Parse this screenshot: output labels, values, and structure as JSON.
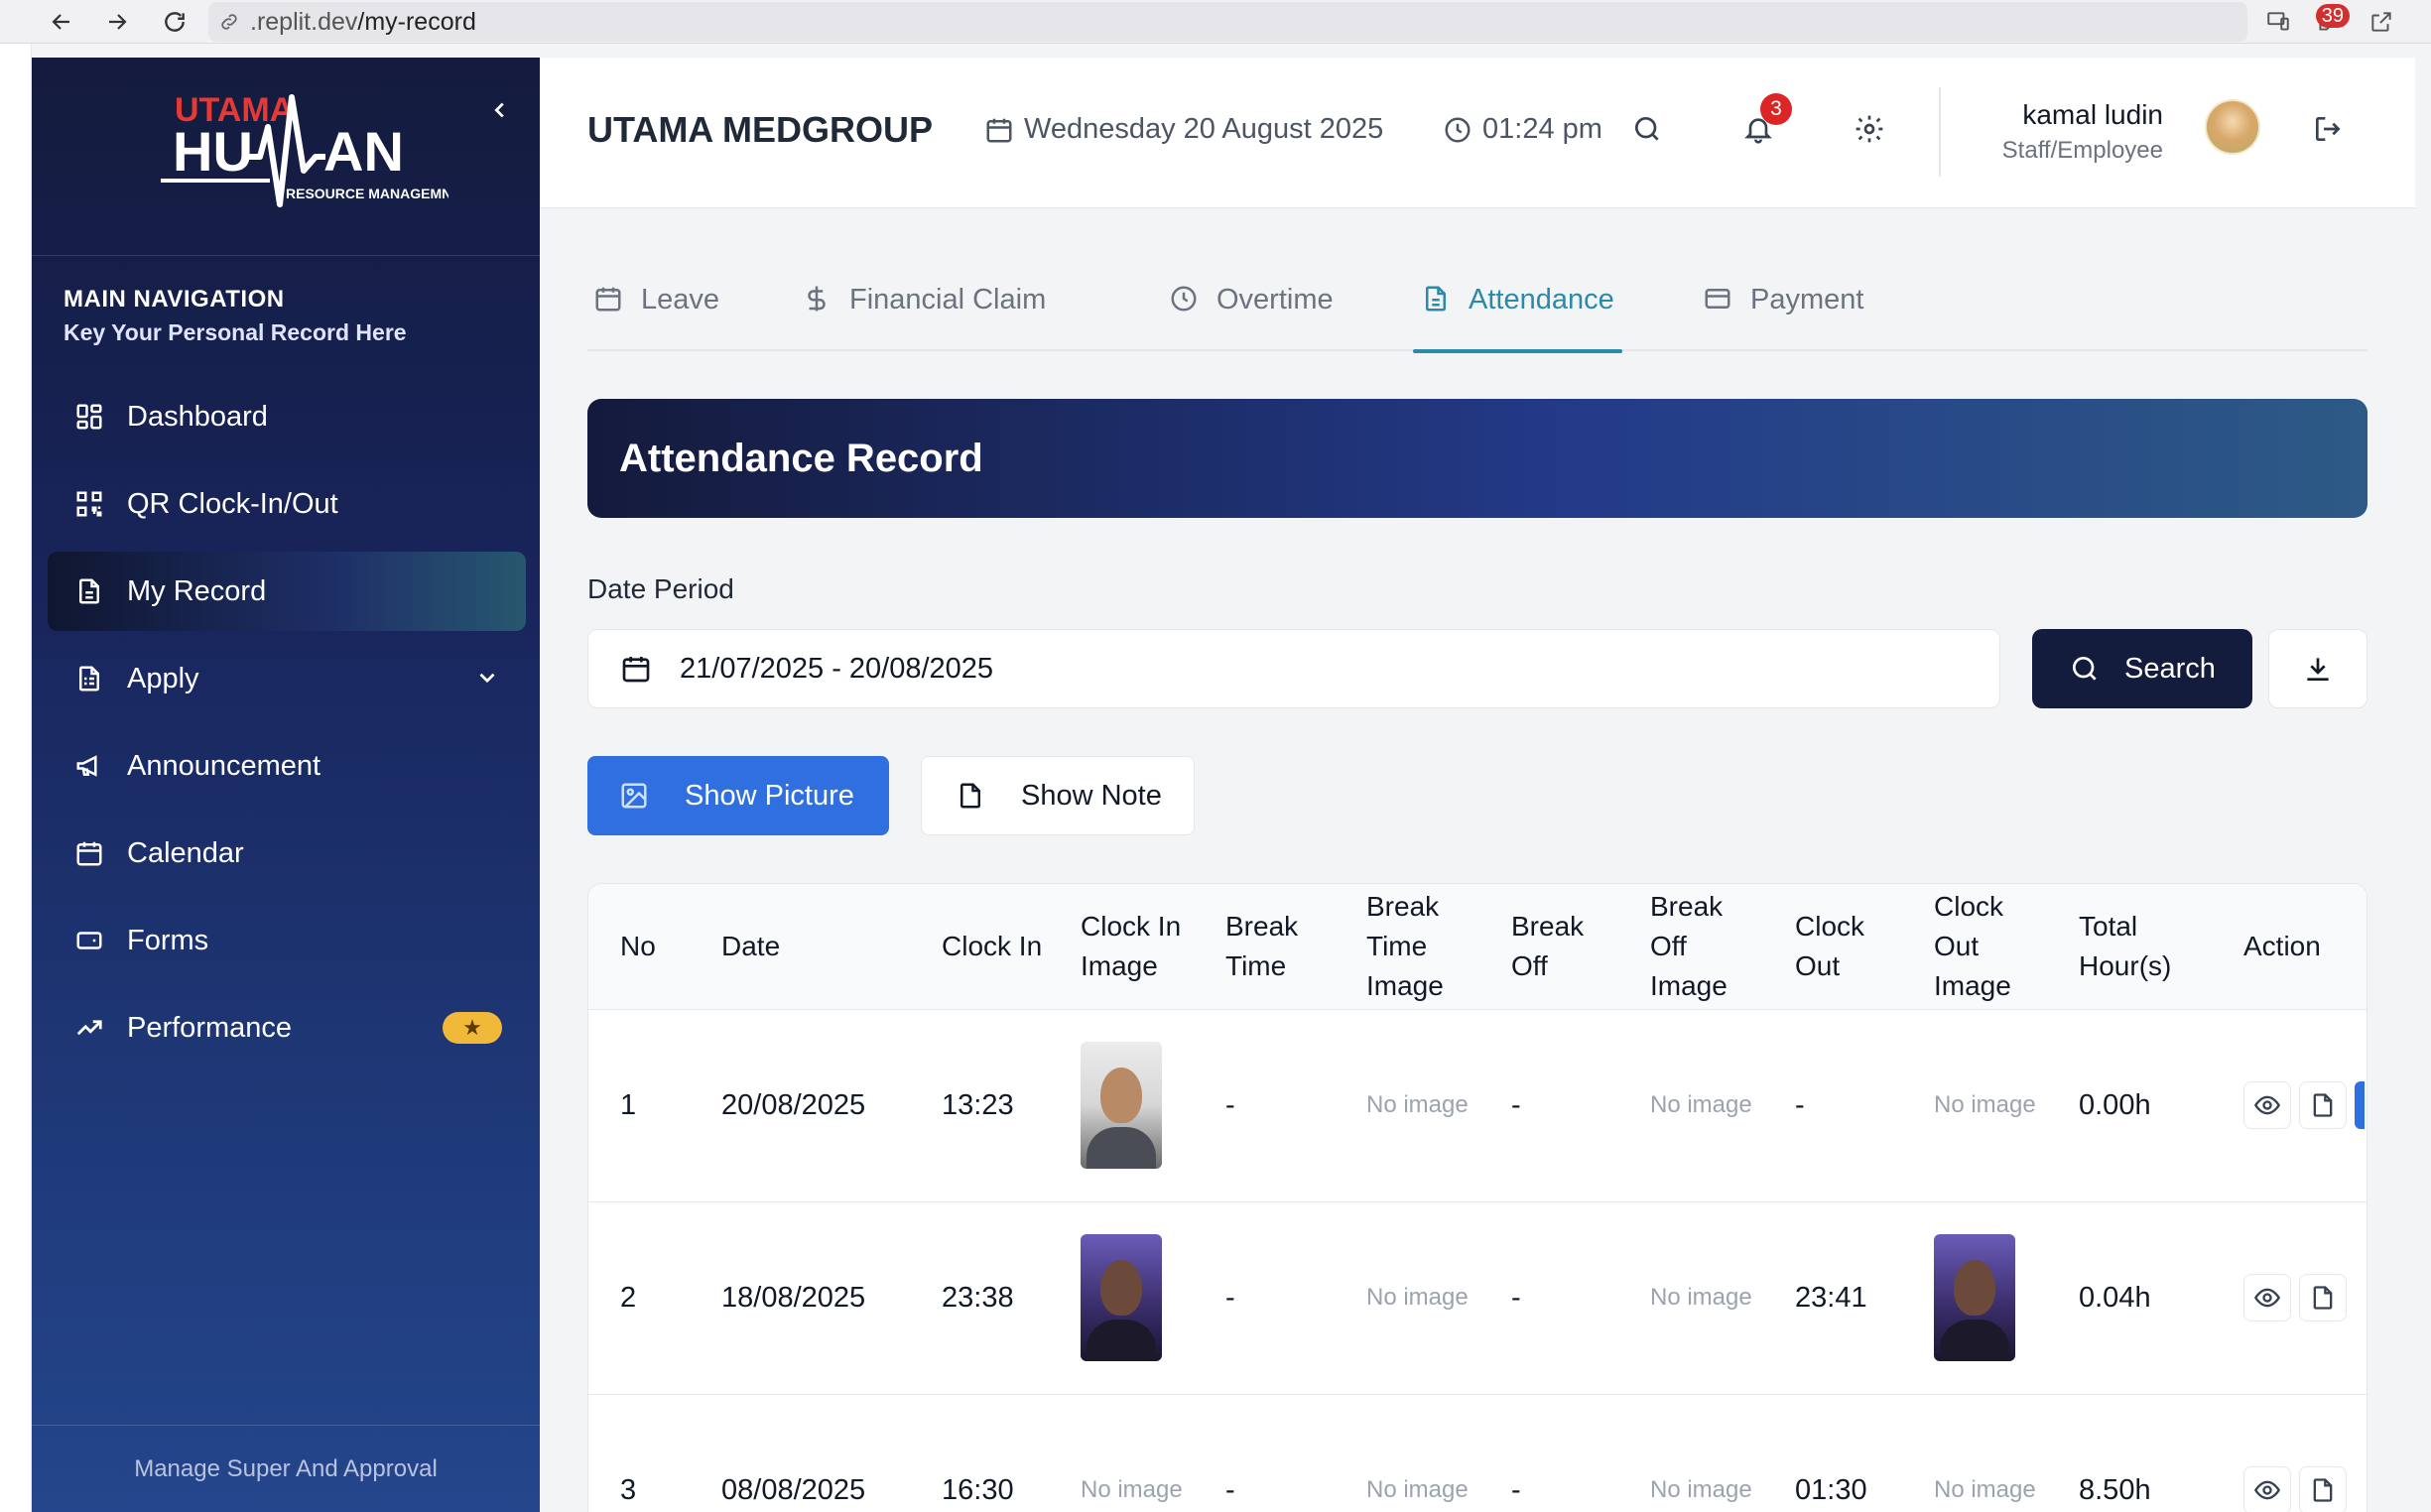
{
  "browser": {
    "url_prefix": ".replit.dev",
    "url_path": "/my-record",
    "ext_badge": "39"
  },
  "sidebar": {
    "logo_top": "UTAMA",
    "logo_main": "HUMAN",
    "logo_sub": "RESOURCE MANAGEMNET",
    "heading": "MAIN NAVIGATION",
    "subheading": "Key Your Personal Record Here",
    "items": [
      {
        "label": "Dashboard",
        "icon": "dashboard-icon"
      },
      {
        "label": "QR Clock-In/Out",
        "icon": "qr-icon"
      },
      {
        "label": "My Record",
        "icon": "document-icon",
        "active": true
      },
      {
        "label": "Apply",
        "icon": "clipboard-icon"
      },
      {
        "label": "Announcement",
        "icon": "megaphone-icon"
      },
      {
        "label": "Calendar",
        "icon": "calendar-icon"
      },
      {
        "label": "Forms",
        "icon": "form-icon"
      },
      {
        "label": "Performance",
        "icon": "trending-up-icon",
        "badge": "★"
      }
    ],
    "footer": "Manage Super And Approval"
  },
  "header": {
    "brand": "UTAMA MEDGROUP",
    "date": "Wednesday 20 August 2025",
    "time": "01:24 pm",
    "notifications": "3",
    "user_name": "kamal ludin",
    "user_role": "Staff/Employee"
  },
  "tabs": [
    {
      "label": "Leave",
      "icon": "calendar-icon"
    },
    {
      "label": "Financial Claim",
      "icon": "dollar-icon"
    },
    {
      "label": "Overtime",
      "icon": "clock-icon"
    },
    {
      "label": "Attendance",
      "icon": "document-icon",
      "active": true
    },
    {
      "label": "Payment",
      "icon": "card-icon"
    }
  ],
  "banner_title": "Attendance Record",
  "filter": {
    "label": "Date Period",
    "value": "21/07/2025 - 20/08/2025",
    "search_label": "Search",
    "show_picture": "Show Picture",
    "show_note": "Show Note"
  },
  "table": {
    "headers": [
      "No",
      "Date",
      "Clock In",
      "Clock In Image",
      "Break Time",
      "Break Time Image",
      "Break Off",
      "Break Off Image",
      "Clock Out",
      "Clock Out Image",
      "Total Hour(s)",
      "Action"
    ],
    "no_image": "No image",
    "rows": [
      {
        "no": "1",
        "date": "20/08/2025",
        "clock_in": "13:23",
        "break_time": "-",
        "break_off": "-",
        "clock_out": "-",
        "total": "0.00h"
      },
      {
        "no": "2",
        "date": "18/08/2025",
        "clock_in": "23:38",
        "break_time": "-",
        "break_off": "-",
        "clock_out": "23:41",
        "total": "0.04h"
      },
      {
        "no": "3",
        "date": "08/08/2025",
        "clock_in": "16:30",
        "break_time": "-",
        "break_off": "-",
        "clock_out": "01:30",
        "total": "8.50h"
      }
    ]
  },
  "colors": {
    "sidebar_top": "#141b3d",
    "sidebar_bottom": "#24468c",
    "accent_tab": "#2b8aa8",
    "primary_button": "#2f6fe0",
    "search_button": "#141c3d",
    "badge": "#dc2626",
    "performance_badge": "#f0b93a"
  }
}
